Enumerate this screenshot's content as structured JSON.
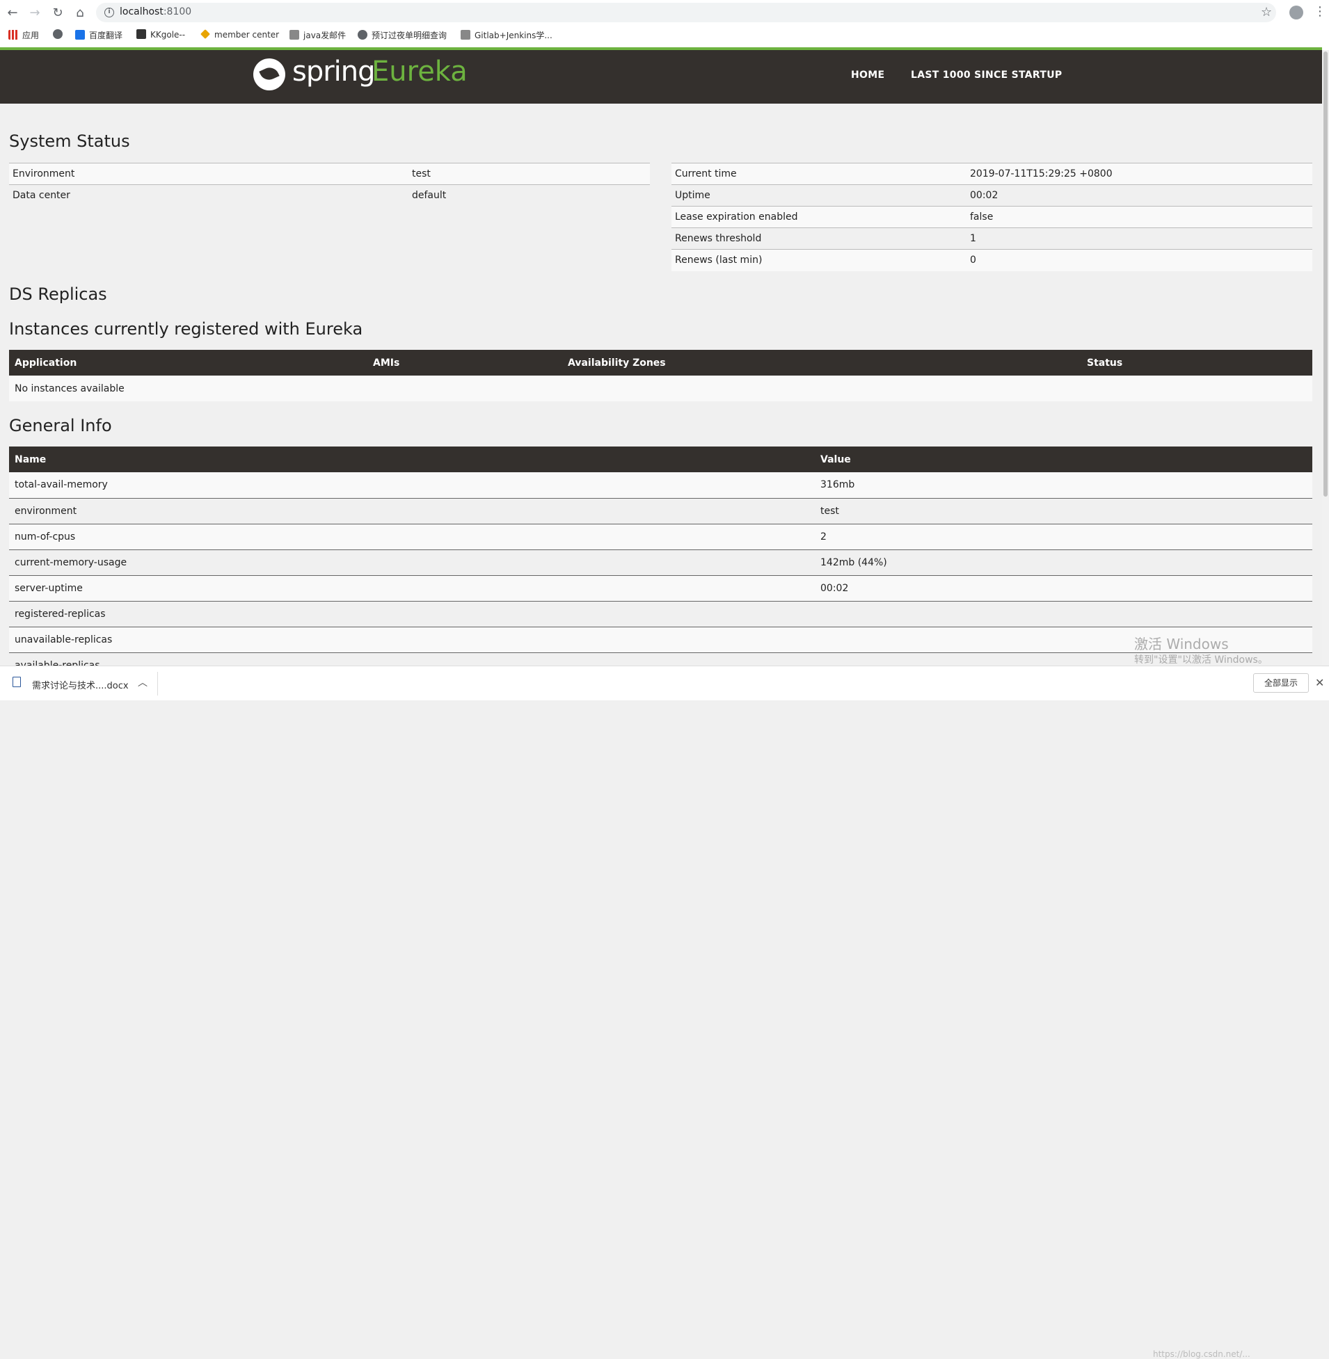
{
  "browser": {
    "url_host": "localhost",
    "url_port": ":8100",
    "bookmarks": [
      {
        "label": "应用",
        "color": "#d93025"
      },
      {
        "label": "",
        "color": "#5f6368"
      },
      {
        "label": "百度翻译",
        "color": "#1a73e8"
      },
      {
        "label": "KKgole--",
        "color": "#333333"
      },
      {
        "label": "member center",
        "color": "#e8a400"
      },
      {
        "label": "java发邮件",
        "color": "#666666"
      },
      {
        "label": "预订过夜单明细查询",
        "color": "#5f6368"
      },
      {
        "label": "Gitlab+Jenkins学...",
        "color": "#666666"
      }
    ]
  },
  "header": {
    "brand": "spring",
    "product": "Eureka",
    "nav": [
      "HOME",
      "LAST 1000 SINCE STARTUP"
    ]
  },
  "system_status": {
    "title": "System Status",
    "left": [
      {
        "key": "Environment",
        "value": "test"
      },
      {
        "key": "Data center",
        "value": "default"
      }
    ],
    "right": [
      {
        "key": "Current time",
        "value": "2019-07-11T15:29:25 +0800"
      },
      {
        "key": "Uptime",
        "value": "00:02"
      },
      {
        "key": "Lease expiration enabled",
        "value": "false"
      },
      {
        "key": "Renews threshold",
        "value": "1"
      },
      {
        "key": "Renews (last min)",
        "value": "0"
      }
    ]
  },
  "ds_replicas": {
    "title": "DS Replicas"
  },
  "instances": {
    "title": "Instances currently registered with Eureka",
    "headers": [
      "Application",
      "AMIs",
      "Availability Zones",
      "Status"
    ],
    "empty_message": "No instances available"
  },
  "general_info": {
    "title": "General Info",
    "headers": [
      "Name",
      "Value"
    ],
    "rows": [
      {
        "name": "total-avail-memory",
        "value": "316mb"
      },
      {
        "name": "environment",
        "value": "test"
      },
      {
        "name": "num-of-cpus",
        "value": "2"
      },
      {
        "name": "current-memory-usage",
        "value": "142mb (44%)"
      },
      {
        "name": "server-uptime",
        "value": "00:02"
      },
      {
        "name": "registered-replicas",
        "value": ""
      },
      {
        "name": "unavailable-replicas",
        "value": ""
      },
      {
        "name": "available-replicas",
        "value": ""
      }
    ]
  },
  "download_bar": {
    "file_name": "需求讨论与技术....docx",
    "show_all": "全部显示"
  },
  "overlay": {
    "activate_title": "激活 Windows",
    "activate_sub": "转到\"设置\"以激活 Windows。",
    "blog": "https://blog.csdn.net/..."
  },
  "colors": {
    "accent_green": "#6db33f",
    "header_dark": "#34302d"
  }
}
